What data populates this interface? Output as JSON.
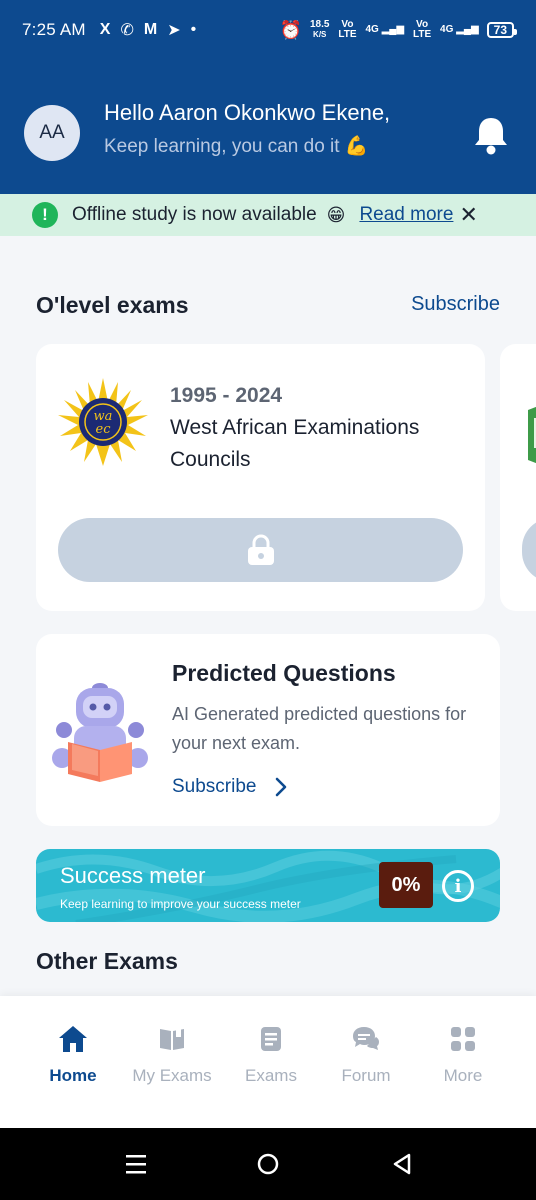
{
  "status_bar": {
    "time": "7:25 AM",
    "app_icons": [
      "X",
      "✆",
      "M",
      "➤",
      "•"
    ],
    "speed": "18.5",
    "speed_unit": "K/S",
    "net1": "Vo LTE",
    "net1_gen": "4G",
    "net2": "Vo LTE",
    "net2_gen": "4G",
    "battery": "73"
  },
  "header": {
    "avatar_initials": "AA",
    "greeting": "Hello Aaron Okonkwo Ekene,",
    "subtitle": "Keep learning, you can do it 💪"
  },
  "banner": {
    "text": "Offline study is now available",
    "emoji": "😁",
    "read_more": "Read more",
    "close": "✕"
  },
  "olevel": {
    "title": "O'level exams",
    "subscribe": "Subscribe",
    "card": {
      "years": "1995 - 2024",
      "name": "West African Examinations Councils",
      "logo_text": "waec"
    }
  },
  "predicted": {
    "title": "Predicted Questions",
    "description": "AI Generated predicted questions for your next exam.",
    "link": "Subscribe"
  },
  "success_meter": {
    "title": "Success meter",
    "subtitle": "Keep learning to improve your success meter",
    "percent": "0%",
    "info": "i"
  },
  "other_exams": {
    "title": "Other Exams"
  },
  "bottom_nav": {
    "items": [
      {
        "label": "Home",
        "icon": "home-icon",
        "active": true
      },
      {
        "label": "My Exams",
        "icon": "book-open-icon",
        "active": false
      },
      {
        "label": "Exams",
        "icon": "document-icon",
        "active": false
      },
      {
        "label": "Forum",
        "icon": "chat-icon",
        "active": false
      },
      {
        "label": "More",
        "icon": "grid-icon",
        "active": false
      }
    ]
  },
  "colors": {
    "primary": "#0d4a8f",
    "banner_bg": "#d5f1e2",
    "meter_bg": "#2cbad0",
    "percent_bg": "#5a1c0e"
  }
}
